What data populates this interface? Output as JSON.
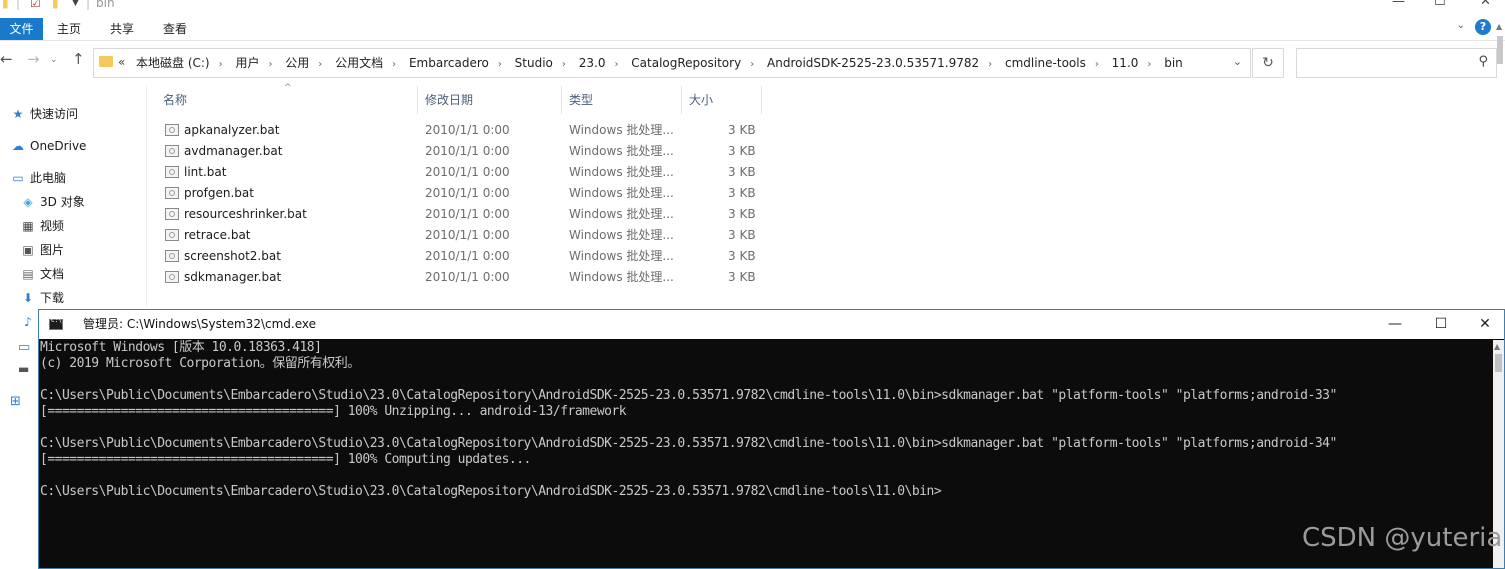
{
  "window": {
    "title": "bin",
    "minimize": "—",
    "maximize": "☐",
    "close": "✕"
  },
  "ribbon": {
    "tabs": [
      "文件",
      "主页",
      "共享",
      "查看"
    ],
    "help": "?"
  },
  "address": {
    "overflow": "«",
    "crumbs": [
      "本地磁盘 (C:)",
      "用户",
      "公用",
      "公用文档",
      "Embarcadero",
      "Studio",
      "23.0",
      "CatalogRepository",
      "AndroidSDK-2525-23.0.53571.9782",
      "cmdline-tools",
      "11.0",
      "bin"
    ],
    "search_placeholder": ""
  },
  "nav_pane": {
    "items": [
      {
        "label": "快速访问",
        "icon": "star-icon"
      },
      {
        "label": "OneDrive",
        "icon": "cloud-icon"
      },
      {
        "label": "此电脑",
        "icon": "computer-icon"
      },
      {
        "label": "3D 对象",
        "icon": "cube-icon"
      },
      {
        "label": "视频",
        "icon": "video-icon"
      },
      {
        "label": "图片",
        "icon": "picture-icon"
      },
      {
        "label": "文档",
        "icon": "document-icon"
      },
      {
        "label": "下载",
        "icon": "download-icon"
      }
    ]
  },
  "file_list": {
    "columns": [
      "名称",
      "修改日期",
      "类型",
      "大小"
    ],
    "rows": [
      {
        "name": "apkanalyzer.bat",
        "date": "2010/1/1 0:00",
        "type": "Windows 批处理...",
        "size": "3 KB"
      },
      {
        "name": "avdmanager.bat",
        "date": "2010/1/1 0:00",
        "type": "Windows 批处理...",
        "size": "3 KB"
      },
      {
        "name": "lint.bat",
        "date": "2010/1/1 0:00",
        "type": "Windows 批处理...",
        "size": "3 KB"
      },
      {
        "name": "profgen.bat",
        "date": "2010/1/1 0:00",
        "type": "Windows 批处理...",
        "size": "3 KB"
      },
      {
        "name": "resourceshrinker.bat",
        "date": "2010/1/1 0:00",
        "type": "Windows 批处理...",
        "size": "3 KB"
      },
      {
        "name": "retrace.bat",
        "date": "2010/1/1 0:00",
        "type": "Windows 批处理...",
        "size": "3 KB"
      },
      {
        "name": "screenshot2.bat",
        "date": "2010/1/1 0:00",
        "type": "Windows 批处理...",
        "size": "3 KB"
      },
      {
        "name": "sdkmanager.bat",
        "date": "2010/1/1 0:00",
        "type": "Windows 批处理...",
        "size": "3 KB"
      }
    ]
  },
  "cmd": {
    "title": "管理员: C:\\Windows\\System32\\cmd.exe",
    "lines": [
      "Microsoft Windows [版本 10.0.18363.418]",
      "(c) 2019 Microsoft Corporation。保留所有权利。",
      "",
      "C:\\Users\\Public\\Documents\\Embarcadero\\Studio\\23.0\\CatalogRepository\\AndroidSDK-2525-23.0.53571.9782\\cmdline-tools\\11.0\\bin>sdkmanager.bat \"platform-tools\" \"platforms;android-33\"",
      "[=======================================] 100% Unzipping... android-13/framework",
      "",
      "C:\\Users\\Public\\Documents\\Embarcadero\\Studio\\23.0\\CatalogRepository\\AndroidSDK-2525-23.0.53571.9782\\cmdline-tools\\11.0\\bin>sdkmanager.bat \"platform-tools\" \"platforms;android-34\"",
      "[=======================================] 100% Computing updates...",
      "",
      "C:\\Users\\Public\\Documents\\Embarcadero\\Studio\\23.0\\CatalogRepository\\AndroidSDK-2525-23.0.53571.9782\\cmdline-tools\\11.0\\bin>"
    ]
  },
  "watermark": "CSDN @yuteria",
  "colors": {
    "accent": "#1979ca",
    "terminal_bg": "#0c0c0c",
    "terminal_fg": "#c8c8c8",
    "folder": "#f4c95d"
  }
}
